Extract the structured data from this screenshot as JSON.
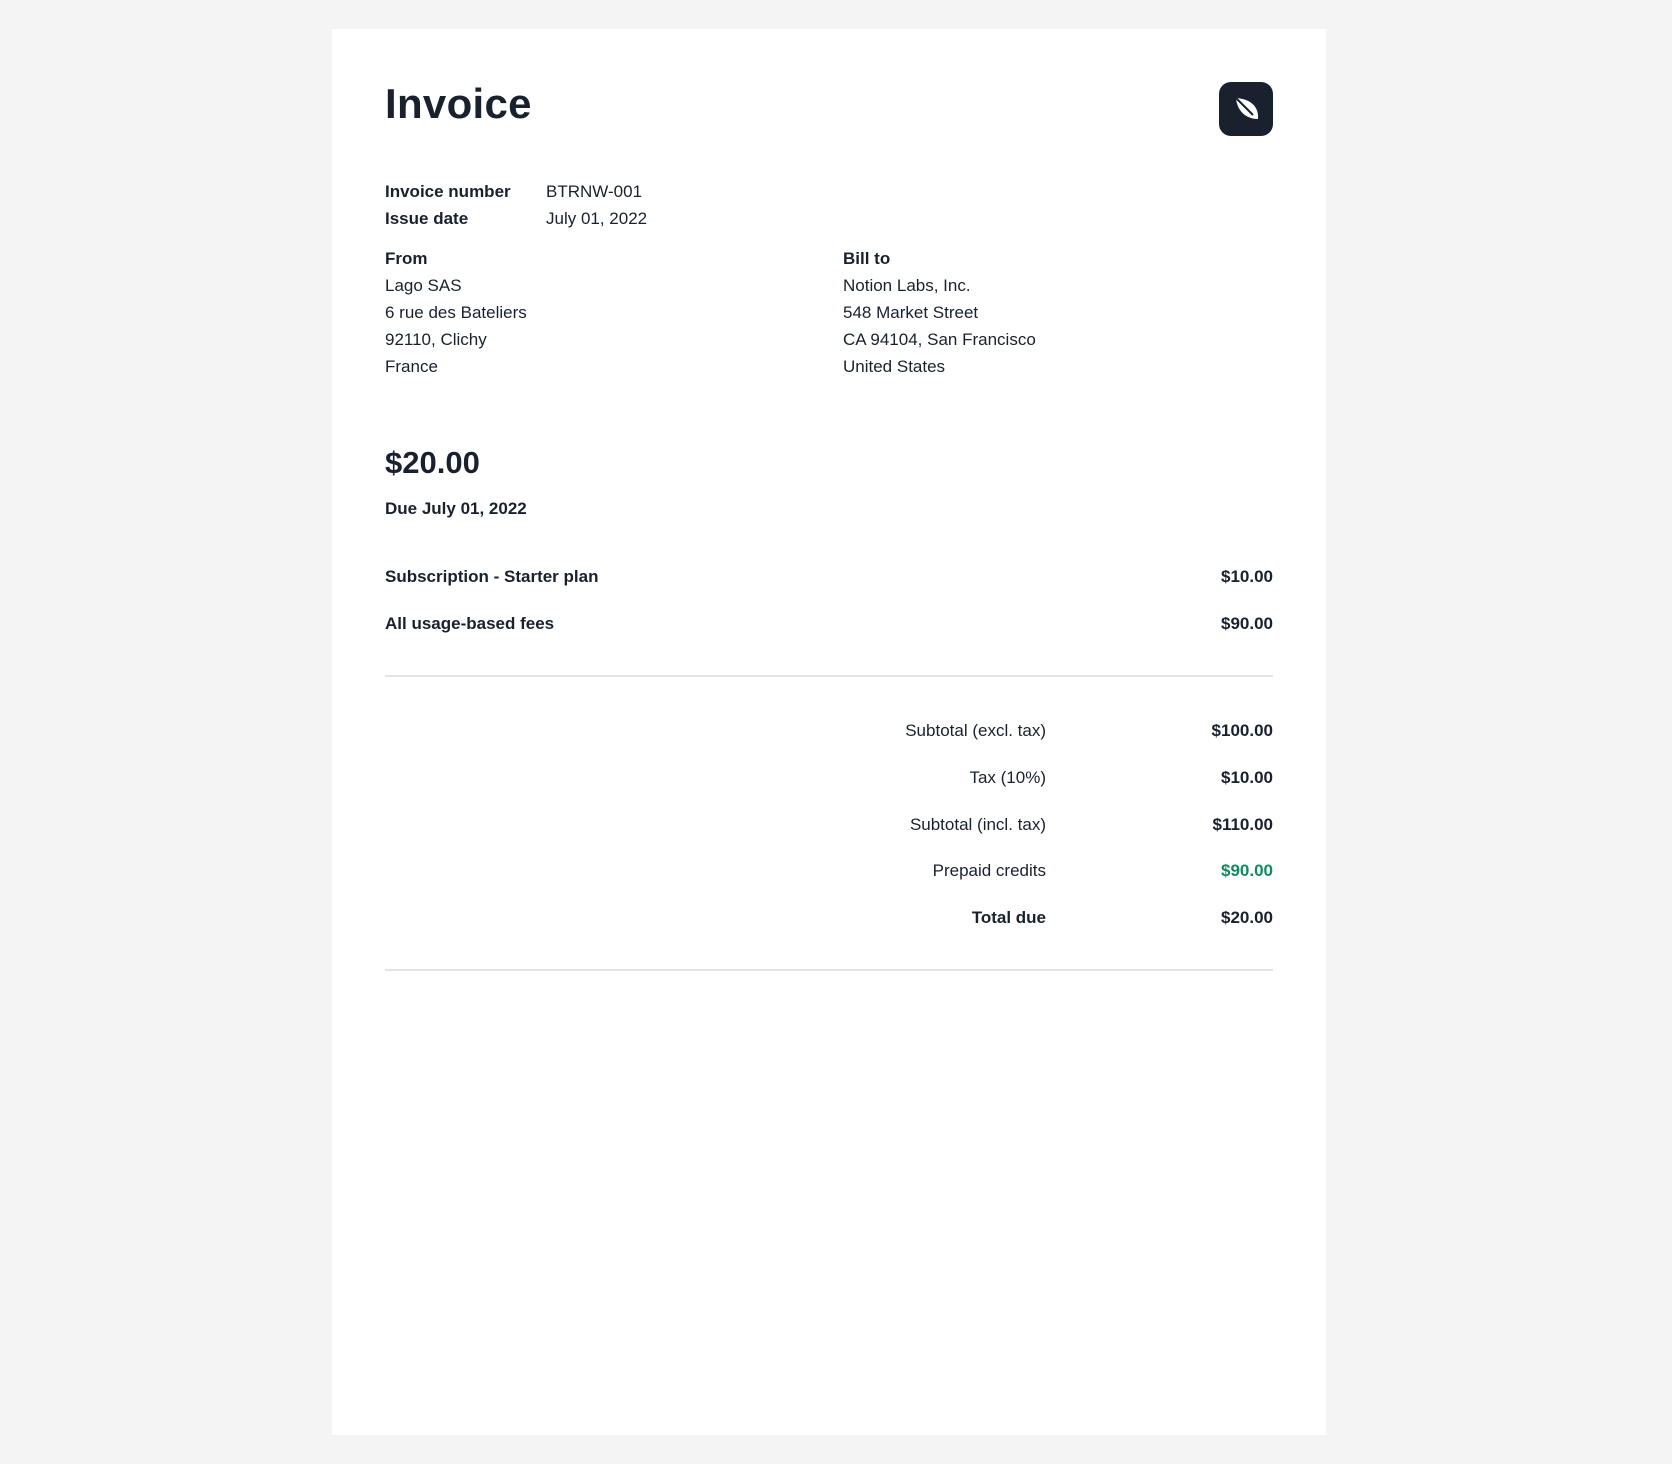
{
  "invoice": {
    "title": "Invoice",
    "logo_icon": "leaf-icon",
    "meta": {
      "number_label": "Invoice number",
      "number_value": "BTRNW-001",
      "date_label": "Issue date",
      "date_value": "July 01, 2022"
    },
    "from": {
      "heading": "From",
      "lines": [
        "Lago SAS",
        "6 rue des Bateliers",
        "92110, Clichy",
        "France"
      ]
    },
    "bill_to": {
      "heading": "Bill to",
      "lines": [
        "Notion Labs, Inc.",
        "548 Market Street",
        "CA 94104, San Francisco",
        "United States"
      ]
    },
    "amount_due": "$20.00",
    "due_text": "Due July 01, 2022",
    "line_items": [
      {
        "label": "Subscription - Starter plan",
        "amount": "$10.00"
      },
      {
        "label": "All usage-based fees",
        "amount": "$90.00"
      }
    ],
    "totals": [
      {
        "label": "Subtotal (excl. tax)",
        "value": "$100.00"
      },
      {
        "label": "Tax (10%)",
        "value": "$10.00"
      },
      {
        "label": "Subtotal (incl. tax)",
        "value": "$110.00"
      },
      {
        "label": "Prepaid credits",
        "value": "$90.00"
      },
      {
        "label": "Total due",
        "value": "$20.00"
      }
    ]
  },
  "colors": {
    "text": "#19212e",
    "credit_green": "#108b5d",
    "divider": "#e2e4e8",
    "background": "#f4f4f4"
  }
}
